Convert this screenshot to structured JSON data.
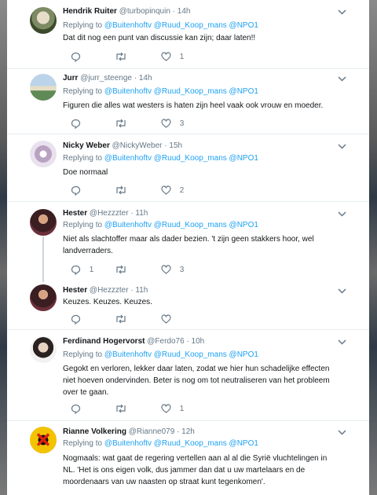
{
  "tweets": [
    {
      "name": "Hendrik Ruiter",
      "handle": "@turbopinquin",
      "time": "· 14h",
      "replying_prefix": "Replying to",
      "replying_to": "@Buitenhoftv @Ruud_Koop_mans @NPO1",
      "text": [
        "Dat dit nog een punt van discussie kan zijn; daar laten!!"
      ],
      "replies": "",
      "retweets": "",
      "likes": "1"
    },
    {
      "name": "Jurr",
      "handle": "@jurr_steenge",
      "time": "· 14h",
      "replying_prefix": "Replying to",
      "replying_to": "@Buitenhoftv @Ruud_Koop_mans @NPO1",
      "text": [
        "Figuren die alles wat westers is haten zijn heel vaak ook vrouw en moeder."
      ],
      "replies": "",
      "retweets": "",
      "likes": "3"
    },
    {
      "name": "Nicky Weber",
      "handle": "@NickyWeber",
      "time": "· 15h",
      "replying_prefix": "Replying to",
      "replying_to": "@Buitenhoftv @Ruud_Koop_mans @NPO1",
      "text": [
        "Doe normaal"
      ],
      "replies": "",
      "retweets": "",
      "likes": "2"
    },
    {
      "name": "Hester",
      "handle": "@Hezzzter",
      "time": "· 11h",
      "replying_prefix": "Replying to",
      "replying_to": "@Buitenhoftv @Ruud_Koop_mans @NPO1",
      "text": [
        "Niet als slachtoffer maar als dader bezien. 't zijn geen stakkers hoor, wel",
        "landverraders."
      ],
      "replies": "1",
      "retweets": "",
      "likes": "3"
    },
    {
      "name": "Hester",
      "handle": "@Hezzzter",
      "time": "· 11h",
      "text": [
        "Keuzes. Keuzes. Keuzes."
      ],
      "replies": "",
      "retweets": "",
      "likes": ""
    },
    {
      "name": "Ferdinand Hogervorst",
      "handle": "@Ferdo76",
      "time": "· 10h",
      "replying_prefix": "Replying to",
      "replying_to": "@Buitenhoftv @Ruud_Koop_mans @NPO1",
      "text": [
        "Gegokt en verloren, lekker daar laten, zodat we hier hun schadelijke effecten",
        "niet hoeven ondervinden. Beter is nog om tot neutraliseren van het probleem",
        "over te gaan."
      ],
      "replies": "",
      "retweets": "",
      "likes": "1"
    },
    {
      "name": "Rianne Volkering",
      "handle": "@Rianne079",
      "time": "· 12h",
      "replying_prefix": "Replying to",
      "replying_to": "@Buitenhoftv @Ruud_Koop_mans @NPO1",
      "text": [
        "Nogmaals: wat gaat de regering vertellen aan al al die Syrië vluchtelingen in",
        "NL. 'Het is ons eigen volk, dus jammer dan dat u uw martelaars en de",
        "moordenaars van uw naasten op straat kunt tegenkomen'."
      ],
      "replies": "",
      "retweets": "",
      "likes": ""
    }
  ],
  "icons": {
    "reply": "reply-icon",
    "retweet": "retweet-icon",
    "like": "heart-icon",
    "more": "chevron-down-icon"
  },
  "colors": {
    "link": "#1da1f2",
    "secondary": "#657786",
    "text": "#14171a"
  }
}
